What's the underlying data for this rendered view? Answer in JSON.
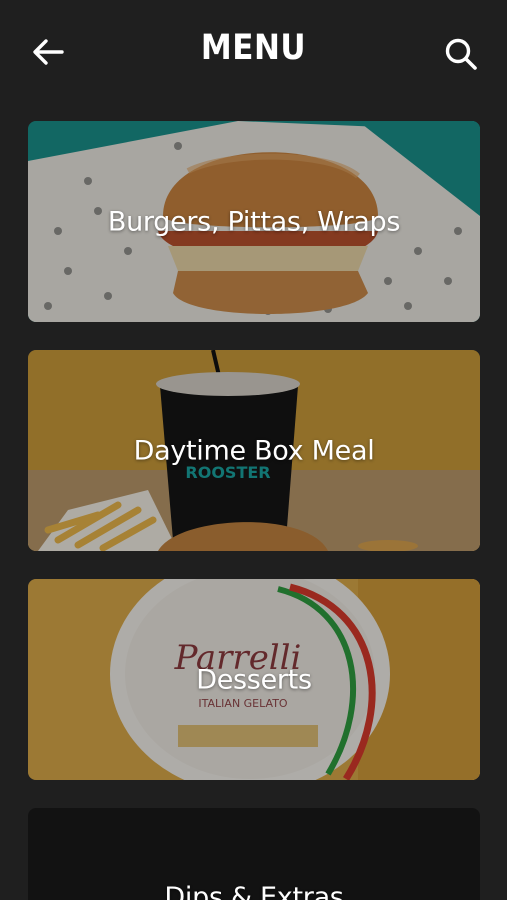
{
  "header": {
    "title": "MENU",
    "back_icon": "arrow-left-icon",
    "search_icon": "search-icon"
  },
  "categories": [
    {
      "label": "Burgers, Pittas, Wraps",
      "image": "burger-photo"
    },
    {
      "label": "Daytime Box Meal",
      "image": "drink-and-fries-photo"
    },
    {
      "label": "Desserts",
      "image": "gelato-tub-photo"
    },
    {
      "label": "Dips & Extras",
      "image": "dark-photo"
    }
  ],
  "colors": {
    "background": "#1f1f1f",
    "burger_card_bg": "#1a8f8a",
    "box_meal_card_bg": "#c99a3a",
    "dessert_card_bg": "#d8a849"
  }
}
